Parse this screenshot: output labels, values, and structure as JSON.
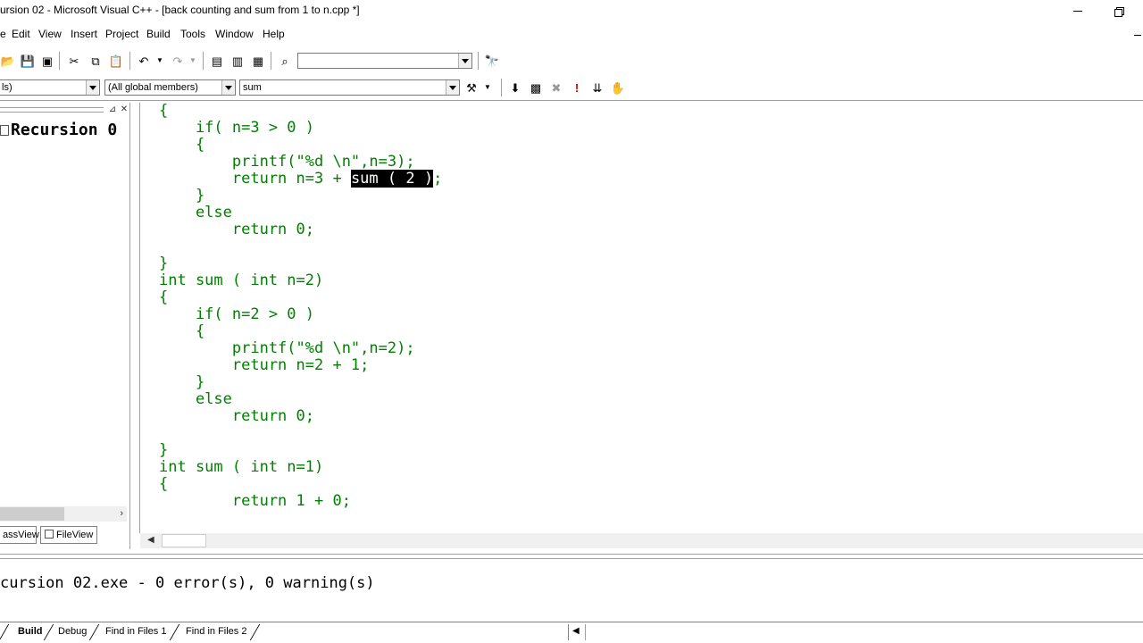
{
  "window": {
    "title": "ursion 02 - Microsoft Visual C++ - [back counting and sum from 1 to n.cpp *]"
  },
  "menu": {
    "file_stub": "e",
    "items": [
      "Edit",
      "View",
      "Insert",
      "Project",
      "Build",
      "Tools",
      "Window",
      "Help"
    ]
  },
  "toolbar": {
    "find_combo_value": "",
    "icons": [
      "open-icon",
      "save-icon",
      "save-all-icon",
      "cut-icon",
      "copy-icon",
      "paste-icon",
      "undo-icon",
      "redo-icon",
      "workspace-icon",
      "output-icon",
      "window-list-icon",
      "find-in-files-icon",
      "find-icon"
    ]
  },
  "wizardbar": {
    "class_combo": "ls)",
    "filter_combo": "(All global members)",
    "members_combo": "sum",
    "icons": [
      "wizard-action-icon",
      "compile-icon",
      "build-icon",
      "stop-build-icon",
      "execute-icon",
      "go-icon",
      "breakpoint-icon"
    ]
  },
  "workspace": {
    "root_label": "Recursion 0",
    "tabs": [
      "assView",
      "FileView"
    ]
  },
  "editor": {
    "lines": [
      "{",
      "    if( n=3 > 0 )",
      "    {",
      "        printf(\"%d \\n\",n=3);",
      "        return n=3 + ",
      "    }",
      "    else",
      "        return 0;",
      "",
      "}",
      "int sum ( int n=2)",
      "{",
      "    if( n=2 > 0 )",
      "    {",
      "        printf(\"%d \\n\",n=2);",
      "        return n=2 + 1;",
      "    }",
      "    else",
      "        return 0;",
      "",
      "}",
      "int sum ( int n=1)",
      "{",
      "        return 1 + 0;"
    ],
    "selected_text": "sum ( 2 )",
    "after_selection": ";"
  },
  "output": {
    "line": "cursion 02.exe - 0 error(s), 0 warning(s)",
    "tabs": [
      "Build",
      "Debug",
      "Find in Files 1",
      "Find in Files 2"
    ]
  }
}
